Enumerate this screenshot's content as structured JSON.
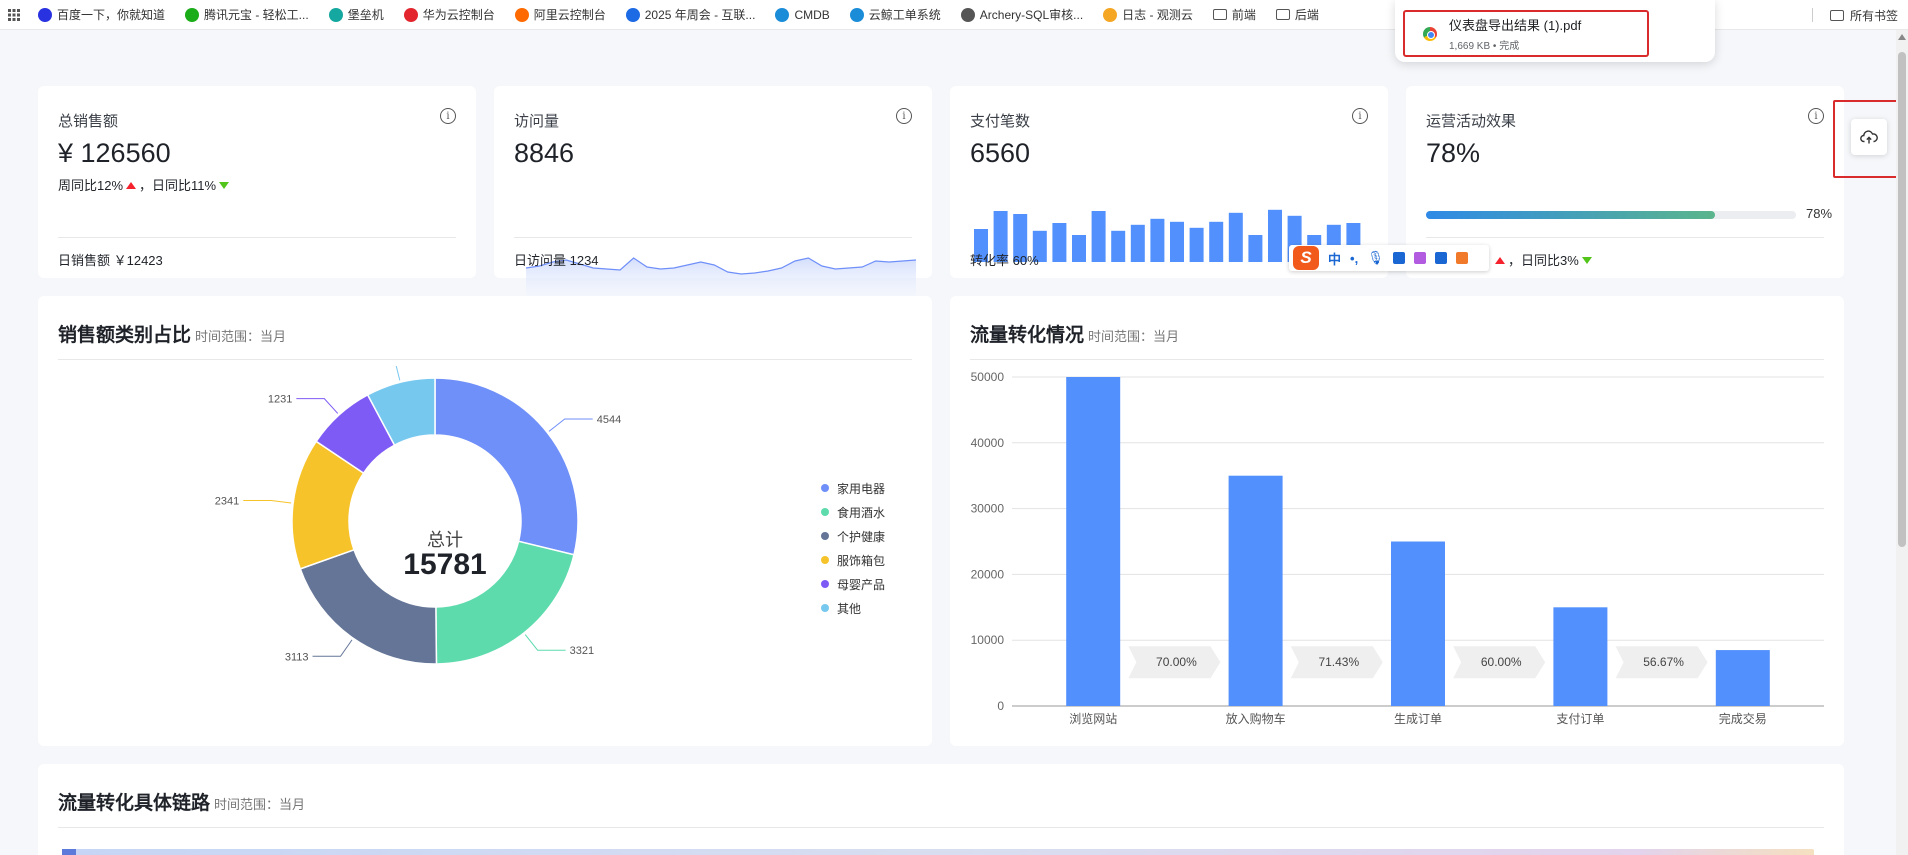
{
  "bookmarks": {
    "items": [
      {
        "label": "百度一下，你就知道",
        "icon": "baidu-icon",
        "color": "#2932e1"
      },
      {
        "label": "腾讯元宝 - 轻松工...",
        "icon": "yuanbao-icon",
        "color": "#1aad19"
      },
      {
        "label": "堡垒机",
        "icon": "bastion-icon",
        "color": "#14a8a0"
      },
      {
        "label": "华为云控制台",
        "icon": "huawei-icon",
        "color": "#e3262e"
      },
      {
        "label": "阿里云控制台",
        "icon": "aliyun-icon",
        "color": "#ff6a00"
      },
      {
        "label": "2025 年周会 - 互联...",
        "icon": "confluence-icon",
        "color": "#1d6ae5"
      },
      {
        "label": "CMDB",
        "icon": "cmdb-icon",
        "color": "#1a8cd8"
      },
      {
        "label": "云鲸工单系统",
        "icon": "whale-icon",
        "color": "#1a8cd8"
      },
      {
        "label": "Archery-SQL审核...",
        "icon": "globe-icon",
        "color": "#555555"
      },
      {
        "label": "日志 - 观测云",
        "icon": "guance-icon",
        "color": "#f5a623"
      },
      {
        "label": "前端",
        "icon": "folder-icon",
        "color": "#555555"
      },
      {
        "label": "后端",
        "icon": "folder-icon",
        "color": "#555555"
      }
    ],
    "all_bookmarks": "所有书签"
  },
  "download": {
    "file_name": "仪表盘导出结果 (1).pdf",
    "meta": "1,669 KB • 完成"
  },
  "stats": {
    "sales": {
      "title": "总销售额",
      "value": "¥ 126560",
      "week_label": "周同比12%",
      "day_label": "，日同比11%",
      "footer": "日销售额 ￥12423"
    },
    "visits": {
      "title": "访问量",
      "value": "8846",
      "footer": "日访问量 1234",
      "sparkline": [
        30,
        32,
        36,
        38,
        34,
        30,
        29,
        28,
        40,
        31,
        29,
        30,
        33,
        36,
        33,
        26,
        24,
        25,
        27,
        30,
        37,
        40,
        32,
        29,
        30,
        31,
        37,
        36,
        37,
        38
      ]
    },
    "payments": {
      "title": "支付笔数",
      "value": "6560",
      "footer": "转化率 60%",
      "bars": [
        55,
        85,
        80,
        52,
        65,
        45,
        85,
        52,
        62,
        72,
        67,
        57,
        67,
        82,
        45,
        87,
        77,
        45,
        62,
        65
      ]
    },
    "campaign": {
      "title": "运营活动效果",
      "value": "78%",
      "progress": 0.78,
      "progress_label": "78%",
      "footer_day": "，日同比3%"
    }
  },
  "ime": {
    "logo": "S",
    "mode": "中",
    "punct": "•,"
  },
  "pie_section": {
    "title": "销售额类别占比",
    "range": "时间范围：当月",
    "center_label": "总计",
    "center_value": "15781"
  },
  "bar_section": {
    "title": "流量转化情况",
    "range": "时间范围：当月"
  },
  "funnel_section": {
    "title": "流量转化具体链路",
    "range": "时间范围：当月"
  },
  "chart_data": [
    {
      "type": "pie",
      "categories": [
        "家用电器",
        "食用酒水",
        "个护健康",
        "服饰箱包",
        "母婴产品",
        "其他"
      ],
      "values": [
        4544,
        3321,
        3113,
        2341,
        1231,
        1231
      ],
      "colors": [
        "#6f8ff9",
        "#5ddbad",
        "#647597",
        "#f6c32a",
        "#7f5bf5",
        "#77c8ef"
      ],
      "legend": "right"
    },
    {
      "type": "bar",
      "categories": [
        "浏览网站",
        "放入购物车",
        "生成订单",
        "支付订单",
        "完成交易"
      ],
      "values": [
        50000,
        35000,
        25000,
        15000,
        8500
      ],
      "conversion_labels": [
        "70.00%",
        "71.43%",
        "60.00%",
        "56.67%"
      ],
      "yticks": [
        0,
        10000,
        20000,
        30000,
        40000,
        50000
      ],
      "ylim": [
        0,
        50000
      ],
      "color": "#5291fd",
      "grid": true
    }
  ]
}
